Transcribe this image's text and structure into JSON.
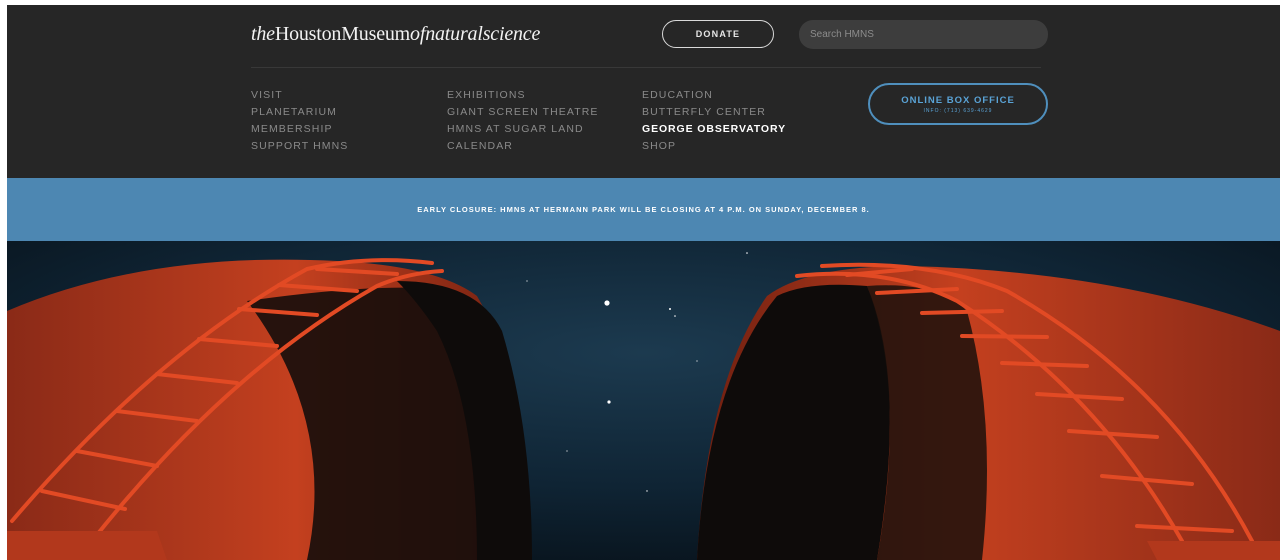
{
  "header": {
    "logo": {
      "the": "the",
      "houston": "HoustonMuseum",
      "of": "of",
      "natural": "natural",
      "science": "science"
    },
    "donate_label": "DONATE",
    "search": {
      "placeholder": "Search HMNS"
    },
    "box_office": {
      "label": "ONLINE BOX OFFICE",
      "info": "INFO: (713) 639-4629"
    }
  },
  "nav": {
    "col1": [
      "VISIT",
      "PLANETARIUM",
      "MEMBERSHIP",
      "SUPPORT HMNS"
    ],
    "col2": [
      "EXHIBITIONS",
      "GIANT SCREEN THEATRE",
      "HMNS AT SUGAR LAND",
      "CALENDAR"
    ],
    "col3": [
      "EDUCATION",
      "BUTTERFLY CENTER",
      "GEORGE OBSERVATORY",
      "SHOP"
    ],
    "active": "GEORGE OBSERVATORY"
  },
  "alert": {
    "text": "EARLY CLOSURE: HMNS AT HERMANN PARK WILL BE CLOSING AT 4 P.M. ON SUNDAY, DECEMBER 8."
  },
  "colors": {
    "header_bg": "#262626",
    "alert_bg": "#4d87b2",
    "accent_blue": "#5aa3d6",
    "dome_red": "#c83a1f",
    "sky": "#0f2434"
  }
}
